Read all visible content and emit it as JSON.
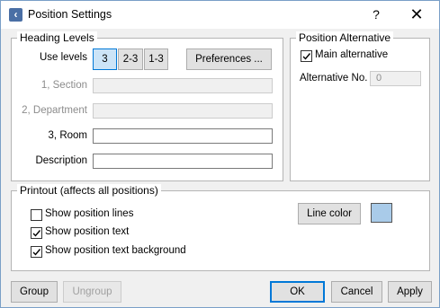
{
  "window": {
    "title": "Position Settings",
    "help": "?",
    "close": "✕",
    "icon": "app-icon"
  },
  "heading_levels": {
    "legend": "Heading Levels",
    "use_levels_label": "Use levels",
    "level_options": [
      "3",
      "2-3",
      "1-3"
    ],
    "selected_level": "3",
    "preferences_button": "Preferences ...",
    "section_label": "1, Section",
    "section_value": "",
    "department_label": "2, Department",
    "department_value": "",
    "room_label": "3, Room",
    "room_value": "",
    "description_label": "Description",
    "description_value": ""
  },
  "position_alternative": {
    "legend": "Position Alternative",
    "main_alternative_label": "Main alternative",
    "main_alternative_checked": true,
    "alternative_no_label": "Alternative No.",
    "alternative_no_value": "0"
  },
  "printout": {
    "legend": "Printout (affects all positions)",
    "show_position_lines": "Show position lines",
    "show_position_lines_checked": false,
    "show_position_text": "Show position text",
    "show_position_text_checked": true,
    "show_position_text_background": "Show position text background",
    "show_position_text_background_checked": true,
    "line_color_button": "Line color",
    "line_color": "#a9cbe9"
  },
  "footer": {
    "group": "Group",
    "ungroup": "Ungroup",
    "ok": "OK",
    "cancel": "Cancel",
    "apply": "Apply"
  }
}
